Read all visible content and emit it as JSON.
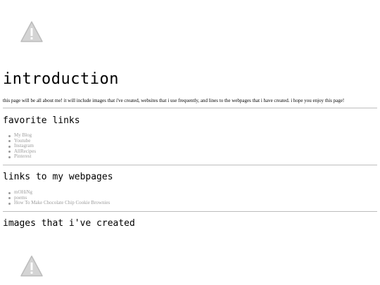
{
  "images": {
    "top_alt": "broken image",
    "bottom_alt": "broken image"
  },
  "intro": {
    "heading": "introduction",
    "text": "this page will be all about me! it will include images that i've created, websites that i use frequently, and lines to the webpages that i have created. i hope you enjoy this page!"
  },
  "favorites": {
    "heading": "favorite links",
    "items": [
      "My Blog",
      "Youtube",
      "Instagram",
      "AllRecipes",
      "Pinterest"
    ]
  },
  "webpages": {
    "heading": "links to my webpages",
    "items": [
      "mOHiNg",
      "poems",
      "How To Make Chocolate Chip Cookie Brownies"
    ]
  },
  "created": {
    "heading": "images that i've created"
  },
  "colors": {
    "link": "#9c9c9c",
    "rule": "#bdbdbd",
    "icon": "#bcbcbc"
  }
}
